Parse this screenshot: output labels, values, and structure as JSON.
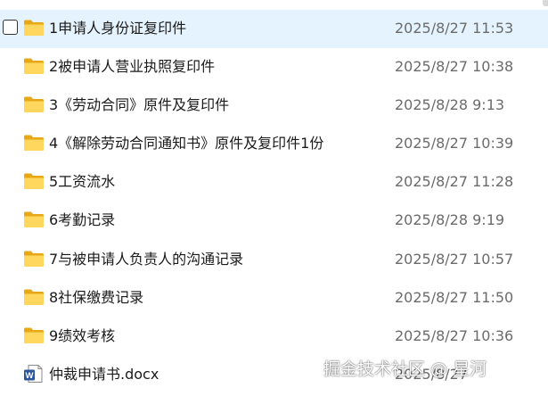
{
  "files": [
    {
      "name": "1申请人身份证复印件",
      "modified": "2025/8/27 11:53",
      "icon": "folder-icon"
    },
    {
      "name": "2被申请人营业执照复印件",
      "modified": "2025/8/27 10:38",
      "icon": "folder-icon"
    },
    {
      "name": "3《劳动合同》原件及复印件",
      "modified": "2025/8/28 9:13",
      "icon": "folder-icon"
    },
    {
      "name": "4《解除劳动合同通知书》原件及复印件1份",
      "modified": "2025/8/27 10:39",
      "icon": "folder-icon"
    },
    {
      "name": "5工资流水",
      "modified": "2025/8/27 11:28",
      "icon": "folder-icon"
    },
    {
      "name": "6考勤记录",
      "modified": "2025/8/28 9:19",
      "icon": "folder-icon"
    },
    {
      "name": "7与被申请人负责人的沟通记录",
      "modified": "2025/8/27 10:57",
      "icon": "folder-icon"
    },
    {
      "name": "8社保缴费记录",
      "modified": "2025/8/27 11:50",
      "icon": "folder-icon"
    },
    {
      "name": "9绩效考核",
      "modified": "2025/8/27 10:36",
      "icon": "folder-icon"
    },
    {
      "name": "仲裁申请书.docx",
      "modified": "2025/8/27",
      "icon": "word-doc-icon"
    }
  ],
  "watermark": "掘金技术社区 @ 星河",
  "colors": {
    "hover_row": "#e5f3ff",
    "folder_front": "#ffd75e",
    "folder_back": "#e8a815",
    "word_blue": "#2b579a",
    "date_text": "#6b6b6b"
  }
}
